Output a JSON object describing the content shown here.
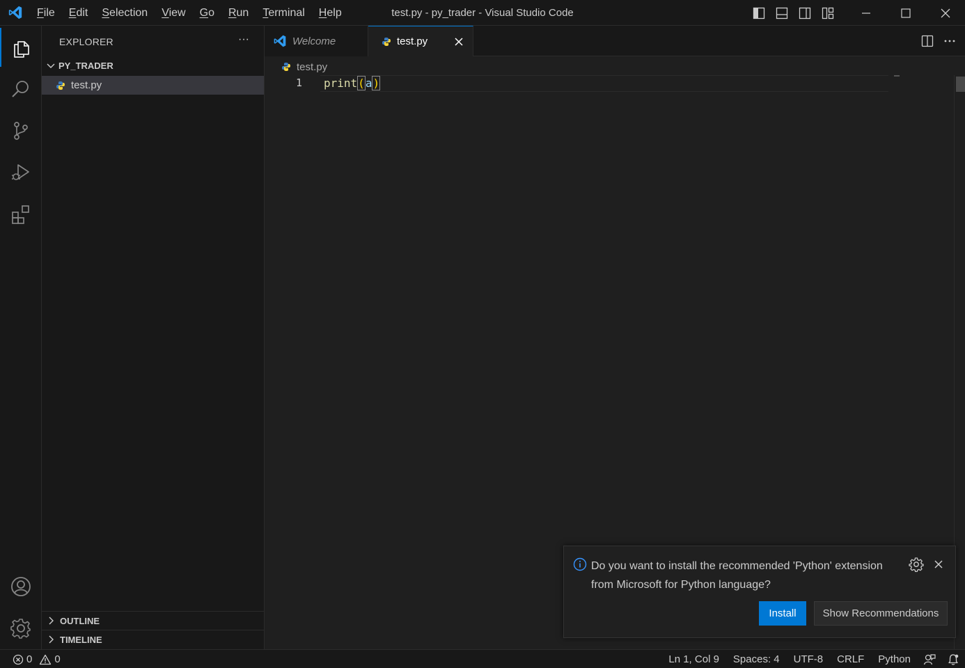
{
  "window": {
    "title": "test.py - py_trader - Visual Studio Code",
    "menu": [
      {
        "first": "F",
        "rest": "ile"
      },
      {
        "first": "E",
        "rest": "dit"
      },
      {
        "first": "S",
        "rest": "election"
      },
      {
        "first": "V",
        "rest": "iew"
      },
      {
        "first": "G",
        "rest": "o"
      },
      {
        "first": "R",
        "rest": "un"
      },
      {
        "first": "T",
        "rest": "erminal"
      },
      {
        "first": "H",
        "rest": "elp"
      }
    ]
  },
  "activitybar": {
    "items": [
      "explorer-icon",
      "search-icon",
      "source-control-icon",
      "run-debug-icon",
      "extensions-icon"
    ],
    "bottom": [
      "account-icon",
      "manage-gear-icon"
    ]
  },
  "sidebar": {
    "title": "EXPLORER",
    "more": "···",
    "folder": "PY_TRADER",
    "files": [
      {
        "name": "test.py",
        "icon": "python-file-icon"
      }
    ],
    "sections": [
      "OUTLINE",
      "TIMELINE"
    ]
  },
  "tabs": [
    {
      "label": "Welcome",
      "icon": "vscode-logo-icon",
      "active": false
    },
    {
      "label": "test.py",
      "icon": "python-file-icon",
      "active": true
    }
  ],
  "editor": {
    "breadcrumb": "test.py",
    "lines": [
      {
        "number": "1",
        "fn": "print",
        "open": "(",
        "arg": "a",
        "close": ")"
      }
    ]
  },
  "notification": {
    "message": "Do you want to install the recommended 'Python' extension from Microsoft for Python language?",
    "install": "Install",
    "recommendations": "Show Recommendations"
  },
  "statusbar": {
    "errors": "0",
    "warnings": "0",
    "position": "Ln 1, Col 9",
    "spaces": "Spaces: 4",
    "encoding": "UTF-8",
    "eol": "CRLF",
    "language": "Python"
  },
  "colors": {
    "accent": "#0078d4",
    "background": "#1f1f1f",
    "chrome": "#181818",
    "python_blue": "#3b7bbf",
    "python_yellow": "#f5d33b"
  }
}
